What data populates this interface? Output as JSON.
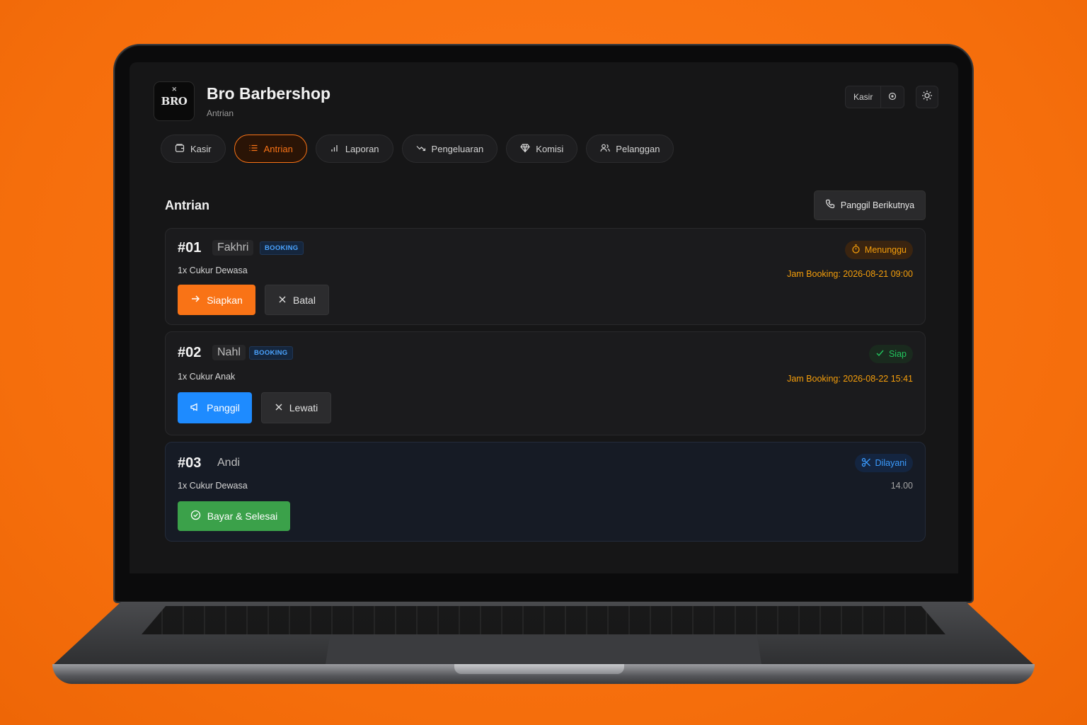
{
  "app": {
    "logo_text": "BRO",
    "title": "Bro Barbershop",
    "subtitle": "Antrian",
    "role": "Kasir",
    "role_icon": "record-icon",
    "theme_icon": "sun-icon"
  },
  "nav": {
    "tabs": [
      {
        "label": "Kasir",
        "icon": "wallet-icon",
        "active": false
      },
      {
        "label": "Antrian",
        "icon": "list-icon",
        "active": true
      },
      {
        "label": "Laporan",
        "icon": "bar-chart-icon",
        "active": false
      },
      {
        "label": "Pengeluaran",
        "icon": "trending-down-icon",
        "active": false
      },
      {
        "label": "Komisi",
        "icon": "gem-icon",
        "active": false
      },
      {
        "label": "Pelanggan",
        "icon": "users-icon",
        "active": false
      }
    ]
  },
  "queue_section": {
    "title": "Antrian",
    "call_next_label": "Panggil Berikutnya",
    "call_next_icon": "phone-icon"
  },
  "queue": [
    {
      "number": "#01",
      "name": "Fakhri",
      "badge": "BOOKING",
      "service": "1x Cukur Dewasa",
      "status": "Menunggu",
      "status_icon": "timer-icon",
      "info": "Jam Booking: 2026-08-21 09:00",
      "primary_action": "Siapkan",
      "secondary_action": "Batal"
    },
    {
      "number": "#02",
      "name": "Nahl",
      "badge": "BOOKING",
      "service": "1x Cukur Anak",
      "status": "Siap",
      "status_icon": "check-icon",
      "info": "Jam Booking: 2026-08-22 15:41",
      "primary_action": "Panggil",
      "secondary_action": "Lewati"
    },
    {
      "number": "#03",
      "name": "Andi",
      "service": "1x Cukur Dewasa",
      "status": "Dilayani",
      "status_icon": "scissors-icon",
      "info": "14.00",
      "primary_action": "Bayar & Selesai"
    }
  ],
  "colors": {
    "accent": "#f97316",
    "blue": "#1e8bff",
    "green": "#3ba14a",
    "amber": "#f59e0b"
  }
}
